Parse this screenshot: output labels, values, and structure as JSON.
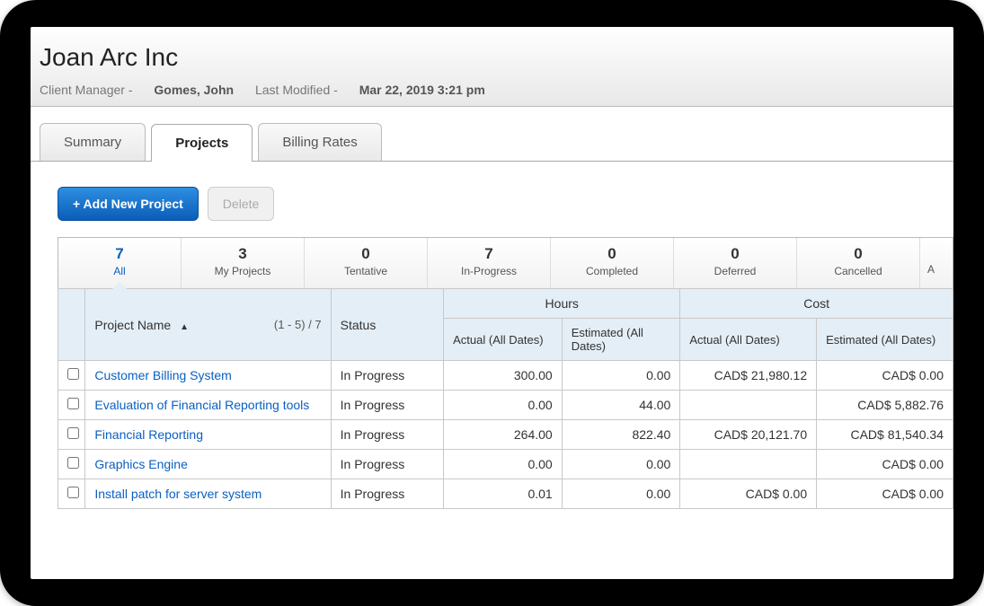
{
  "header": {
    "title": "Joan Arc Inc",
    "mgr_label": "Client Manager -",
    "mgr_value": "Gomes, John",
    "mod_label": "Last Modified -",
    "mod_value": "Mar 22, 2019 3:21 pm"
  },
  "tabs": [
    {
      "label": "Summary",
      "active": false
    },
    {
      "label": "Projects",
      "active": true
    },
    {
      "label": "Billing Rates",
      "active": false
    }
  ],
  "actions": {
    "add": "+ Add New Project",
    "delete": "Delete"
  },
  "filters": [
    {
      "count": "7",
      "label": "All",
      "active": true
    },
    {
      "count": "3",
      "label": "My Projects"
    },
    {
      "count": "0",
      "label": "Tentative"
    },
    {
      "count": "7",
      "label": "In-Progress"
    },
    {
      "count": "0",
      "label": "Completed"
    },
    {
      "count": "0",
      "label": "Deferred"
    },
    {
      "count": "0",
      "label": "Cancelled"
    }
  ],
  "columns": {
    "name": "Project Name",
    "pager": "(1 - 5) / 7",
    "status": "Status",
    "hours_group": "Hours",
    "cost_group": "Cost",
    "hours_actual": "Actual (All Dates)",
    "hours_est": "Estimated (All Dates)",
    "cost_actual": "Actual (All Dates)",
    "cost_est": "Estimated (All Dates)"
  },
  "rows": [
    {
      "name": "Customer Billing System",
      "status": "In Progress",
      "h_act": "300.00",
      "h_est": "0.00",
      "c_act": "CAD$ 21,980.12",
      "c_est": "CAD$ 0.00"
    },
    {
      "name": "Evaluation of Financial Reporting tools",
      "status": "In Progress",
      "h_act": "0.00",
      "h_est": "44.00",
      "c_act": "",
      "c_est": "CAD$ 5,882.76"
    },
    {
      "name": "Financial Reporting",
      "status": "In Progress",
      "h_act": "264.00",
      "h_est": "822.40",
      "c_act": "CAD$ 20,121.70",
      "c_est": "CAD$ 81,540.34"
    },
    {
      "name": "Graphics Engine",
      "status": "In Progress",
      "h_act": "0.00",
      "h_est": "0.00",
      "c_act": "",
      "c_est": "CAD$ 0.00"
    },
    {
      "name": "Install patch for server system",
      "status": "In Progress",
      "h_act": "0.01",
      "h_est": "0.00",
      "c_act": "CAD$ 0.00",
      "c_est": "CAD$ 0.00"
    }
  ]
}
